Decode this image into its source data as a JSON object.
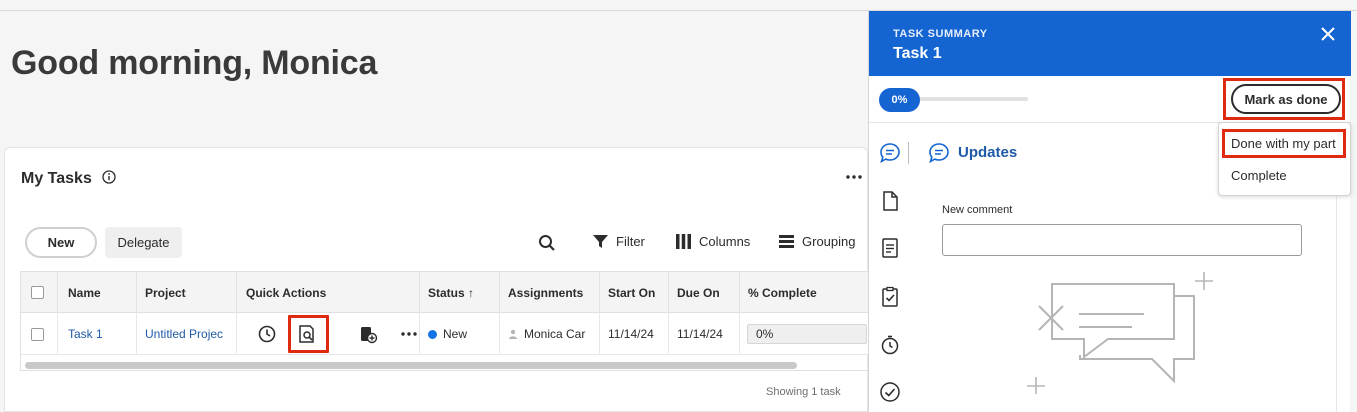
{
  "greeting": "Good morning, Monica",
  "card": {
    "title": "My Tasks",
    "new_label": "New",
    "delegate_label": "Delegate",
    "toolbar": {
      "filter": "Filter",
      "columns": "Columns",
      "grouping": "Grouping"
    },
    "columns": [
      "Name",
      "Project",
      "Quick Actions",
      "Status ↑",
      "Assignments",
      "Start On",
      "Due On",
      "% Complete"
    ],
    "row": {
      "name": "Task 1",
      "project": "Untitled Projec",
      "status": "New",
      "assignment": "Monica Car",
      "start_on": "11/14/24",
      "due_on": "11/14/24",
      "percent_complete": "0%"
    },
    "showing": "Showing 1 task"
  },
  "panel": {
    "subtitle": "TASK SUMMARY",
    "title": "Task 1",
    "progress_label": "0%",
    "progress": 0,
    "mark_done_label": "Mark as done",
    "tab_label": "Updates",
    "comment_label": "New comment",
    "menu": [
      "Done with my part",
      "Complete"
    ]
  },
  "colors": {
    "brand_blue": "#1464d1",
    "highlight_red": "#e02a10",
    "status_new": "#1473e6"
  }
}
